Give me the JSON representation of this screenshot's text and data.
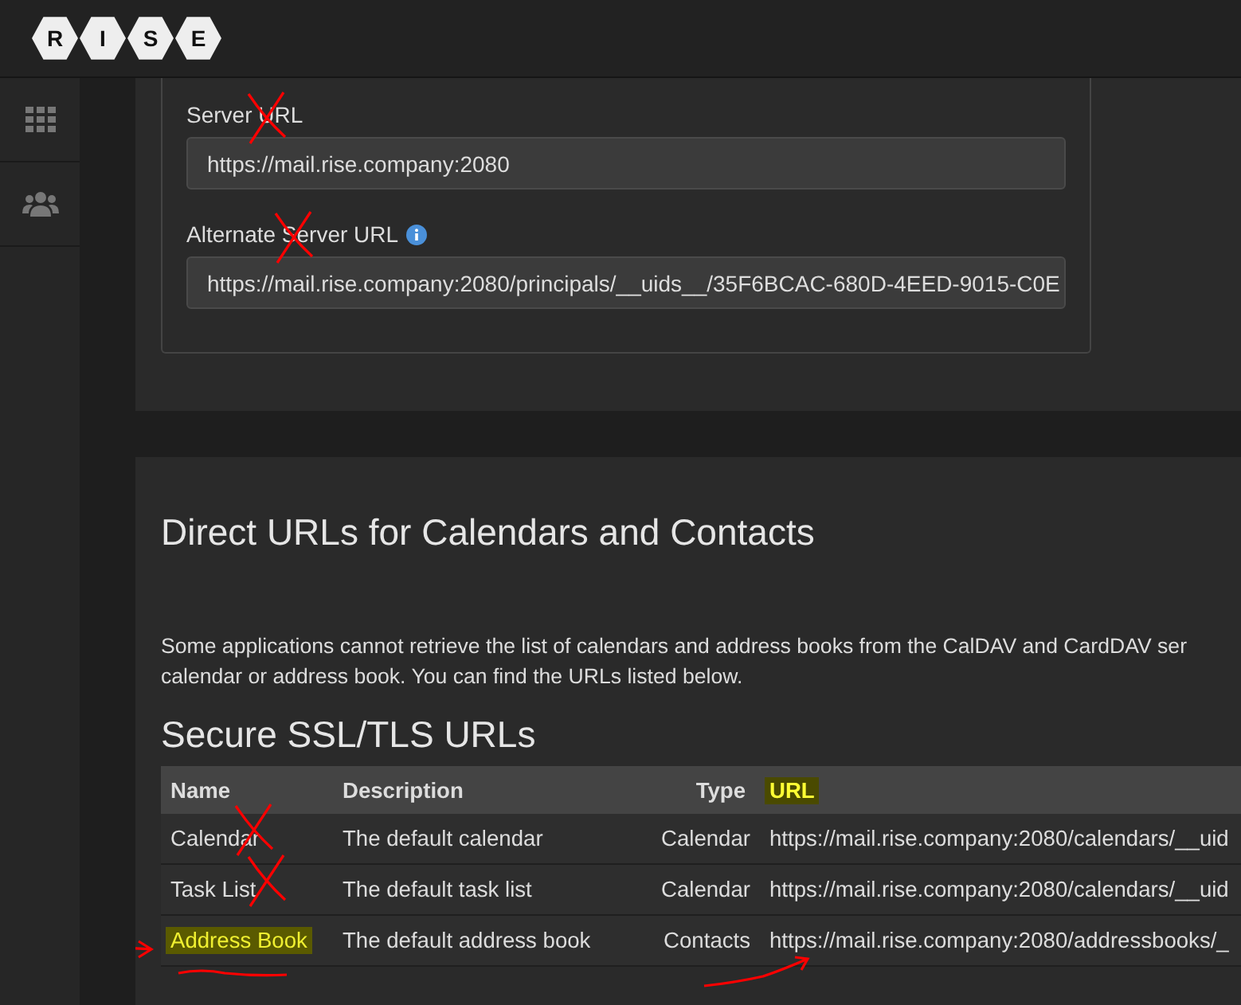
{
  "logo_letters": [
    "R",
    "I",
    "S",
    "E"
  ],
  "sidebar": {
    "items": [
      {
        "kind": "apps",
        "selected": false
      },
      {
        "kind": "team",
        "selected": false
      }
    ]
  },
  "settings": {
    "fields": [
      {
        "label": "Server URL",
        "value": "https://mail.rise.company:2080",
        "info": false,
        "crossed": true
      },
      {
        "label": "Alternate Server URL",
        "value": "https://mail.rise.company:2080/principals/__uids__/35F6BCAC-680D-4EED-9015-C0E",
        "info": true,
        "crossed": true
      }
    ]
  },
  "direct_urls": {
    "title": "Direct URLs for Calendars and Contacts",
    "description": [
      "Some applications cannot retrieve the list of calendars and address books from the CalDAV and CardDAV ser",
      "calendar or address book. You can find the URLs listed below."
    ],
    "section_title": "Secure SSL/TLS URLs",
    "table": {
      "columns": [
        {
          "label": "Name",
          "highlighted": false
        },
        {
          "label": "Description",
          "highlighted": false
        },
        {
          "label": "Type",
          "highlighted": false
        },
        {
          "label": "URL",
          "highlighted": true
        }
      ],
      "rows": [
        {
          "name": "Calendar",
          "description": "The default calendar",
          "type": "Calendar",
          "url": "https://mail.rise.company:2080/calendars/__uid",
          "highlighted": false,
          "name_crossed": true,
          "name_pointed": false,
          "url_pointed": false
        },
        {
          "name": "Task List",
          "description": "The default task list",
          "type": "Calendar",
          "url": "https://mail.rise.company:2080/calendars/__uid",
          "highlighted": false,
          "name_crossed": true,
          "name_pointed": false,
          "url_pointed": false
        },
        {
          "name": "Address Book",
          "description": "The default address book",
          "type": "Contacts",
          "url": "https://mail.rise.company:2080/addressbooks/_",
          "highlighted": true,
          "name_crossed": false,
          "name_pointed": true,
          "url_pointed": true
        }
      ]
    }
  }
}
